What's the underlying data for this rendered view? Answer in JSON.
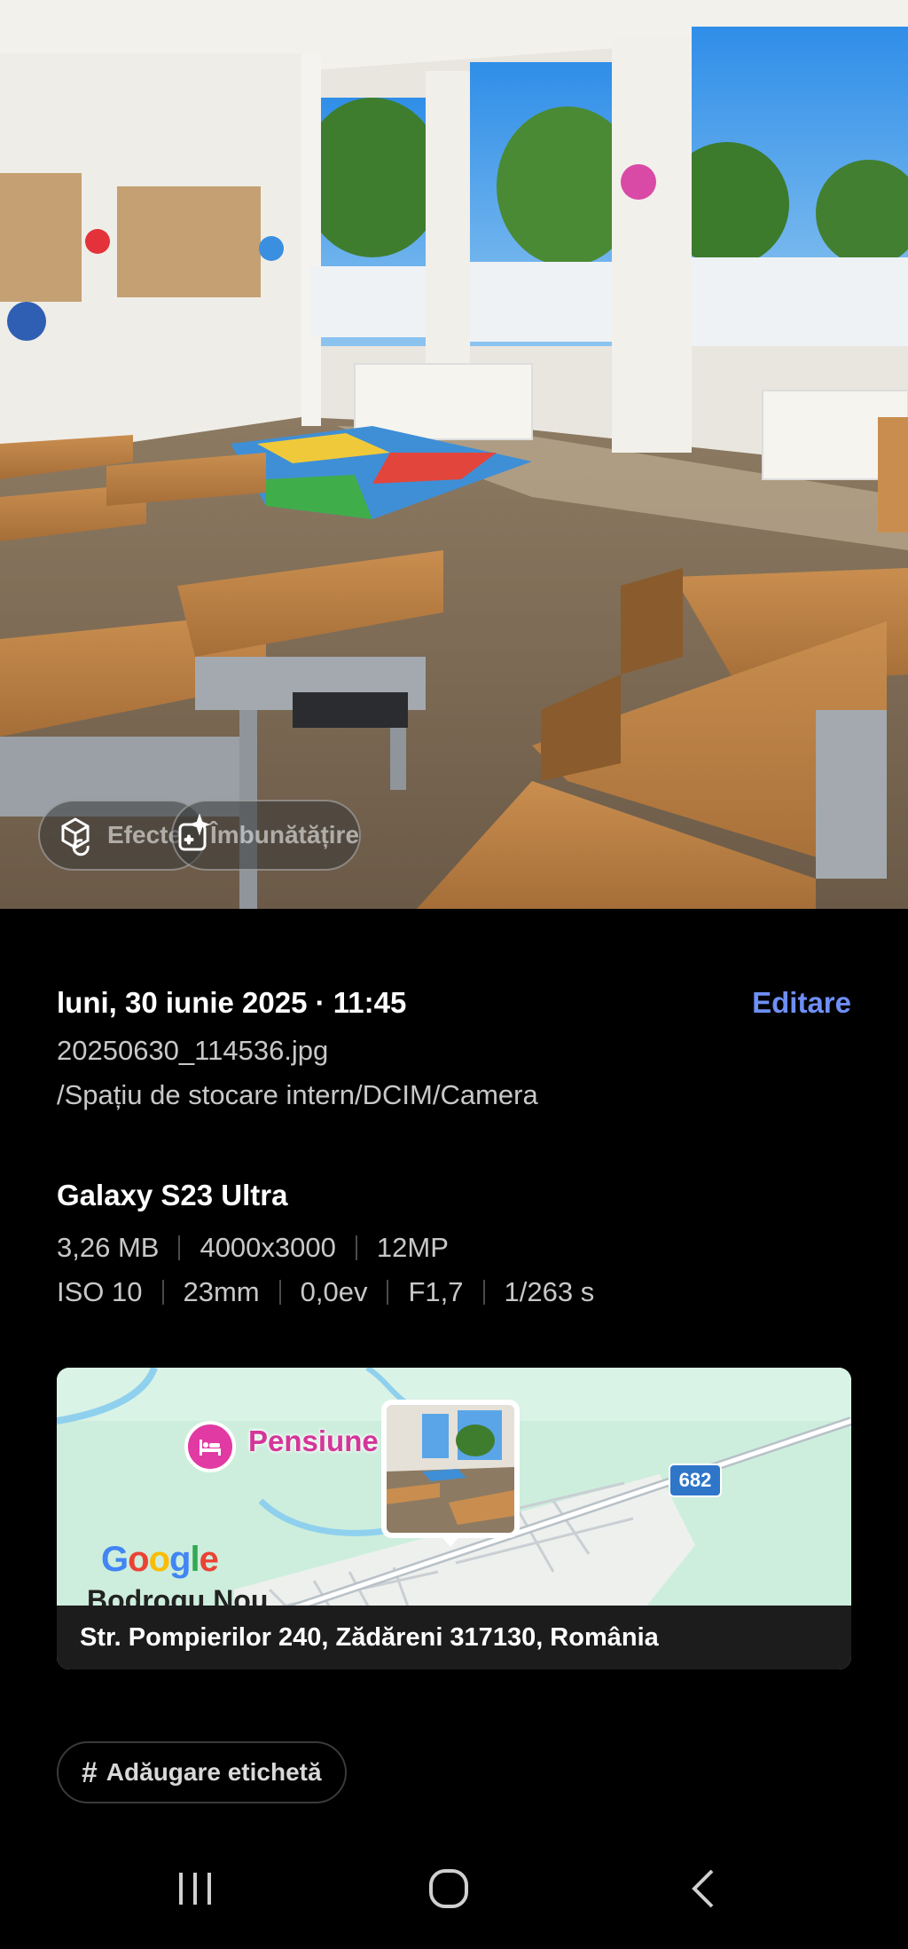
{
  "photo": {
    "chips": {
      "effect_label": "Efecte",
      "enhance_label": "Îmbunătățire"
    }
  },
  "details": {
    "date_time": "luni, 30 iunie 2025 · 11:45",
    "edit_label": "Editare",
    "file_name": "20250630_114536.jpg",
    "file_path": "/Spațiu de stocare intern/DCIM/Camera",
    "device": "Galaxy S23 Ultra",
    "specs_row1": [
      "3,26 MB",
      "4000x3000",
      "12MP"
    ],
    "specs_row2": [
      "ISO 10",
      "23mm",
      "0,0ev",
      "F1,7",
      "1/263 s"
    ]
  },
  "map": {
    "poi_label": "Pensiune",
    "road_number": "682",
    "town_label": "Bodrogu Nou",
    "attribution": "Google",
    "address": "Str. Pompierilor 240, Zădăreni 317130, România"
  },
  "tag": {
    "hash": "#",
    "label": "Adăugare etichetă"
  },
  "colors": {
    "accent": "#6e8ff5",
    "background": "#000000",
    "poi_pink": "#e23aa3",
    "road_badge": "#2f76c9"
  },
  "icons": {
    "effect_chip": "cube-sparkle-icon",
    "enhance_chip": "magic-sparkle-icon",
    "poi": "hotel-bed-icon",
    "nav_recents": "recents-icon",
    "nav_home": "home-icon",
    "nav_back": "back-icon"
  }
}
